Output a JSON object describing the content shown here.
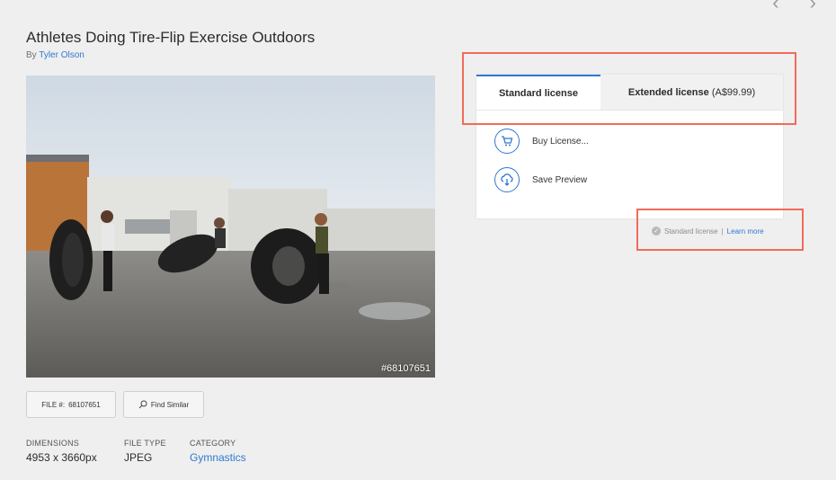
{
  "nav": {
    "arrows": "‹ ›"
  },
  "asset": {
    "title": "Athletes Doing Tire-Flip Exercise Outdoors",
    "by_label": "By",
    "author": "Tyler Olson",
    "watermark_id": "#68107651"
  },
  "file": {
    "label": "FILE #:",
    "number": "68107651",
    "find_similar": "Find Similar"
  },
  "meta": {
    "dimensions_label": "DIMENSIONS",
    "dimensions_value": "4953 x 3660px",
    "filetype_label": "FILE TYPE",
    "filetype_value": "JPEG",
    "category_label": "CATEGORY",
    "category_value": "Gymnastics"
  },
  "license": {
    "tabs": [
      {
        "label": "Standard license",
        "price": ""
      },
      {
        "label": "Extended license",
        "price": "(A$99.99)"
      }
    ],
    "buy_label": "Buy License...",
    "save_label": "Save Preview",
    "note_label": "Standard license",
    "note_separator": "|",
    "learn_more": "Learn more"
  },
  "colors": {
    "accent": "#2d79d2",
    "highlight": "#f06b5a",
    "background": "#efefef"
  }
}
